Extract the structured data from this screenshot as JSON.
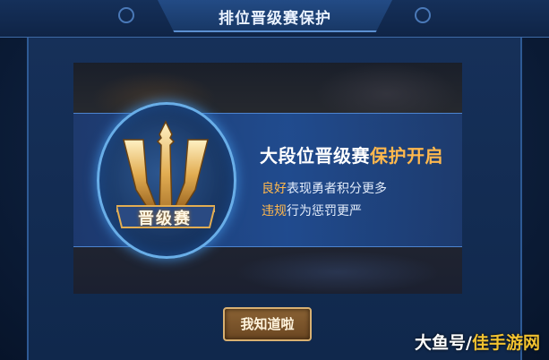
{
  "dialog": {
    "title": "排位晋级赛保护",
    "emblem_label": "晋级赛",
    "headline_main": "大段位晋级赛",
    "headline_highlight": "保护开启",
    "line1_highlight": "良好",
    "line1_rest": "表现勇者积分更多",
    "line2_highlight": "违规",
    "line2_rest": "行为惩罚更严",
    "confirm_button": "我知道啦"
  },
  "watermark": {
    "part1": "大鱼号/",
    "part2": "佳手游网"
  },
  "colors": {
    "highlight": "#ffb84d",
    "panel": "#163059",
    "button_border": "#d8b071",
    "ring": "#69aee8"
  },
  "icons": [
    "qualifier-shield-emblem"
  ]
}
